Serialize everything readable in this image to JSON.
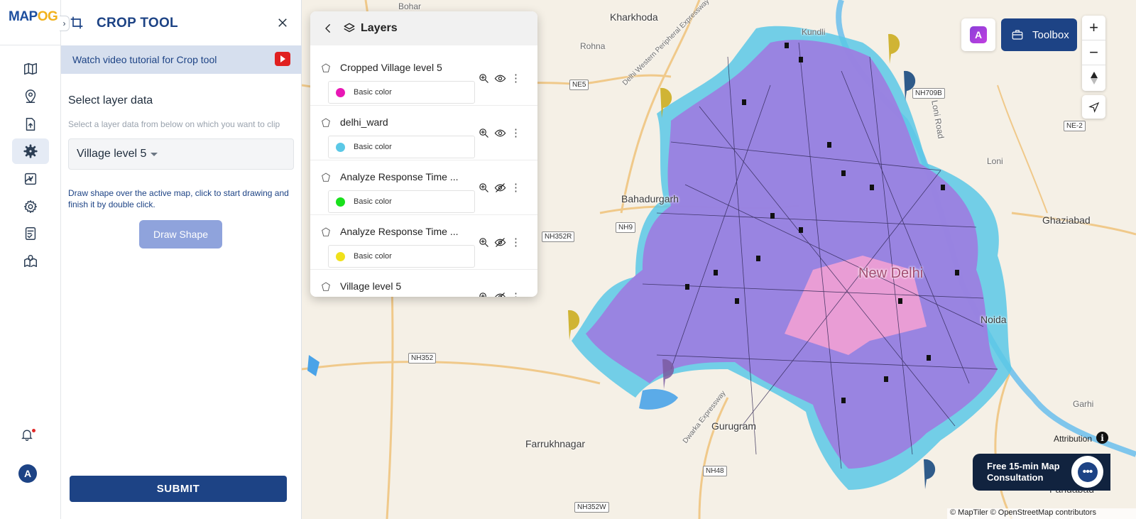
{
  "app": {
    "logo_left": "MAP",
    "logo_right": "OG"
  },
  "rail": {
    "items": [
      {
        "name": "map-icon"
      },
      {
        "name": "location-pin-icon"
      },
      {
        "name": "file-upload-icon"
      },
      {
        "name": "settings-gear-icon",
        "active": true
      },
      {
        "name": "map-marker-icon"
      },
      {
        "name": "gear-icon"
      },
      {
        "name": "report-icon"
      },
      {
        "name": "map-location-icon"
      }
    ],
    "avatar_letter": "A"
  },
  "panel": {
    "title": "CROP TOOL",
    "tutorial_label": "Watch video tutorial for Crop tool",
    "section_title": "Select layer data",
    "section_hint": "Select a layer data from below on which you want to clip",
    "selected_layer": "Village level 5",
    "draw_hint": "Draw shape over the active map, click to start drawing and finish it by double click.",
    "draw_button": "Draw Shape",
    "submit_button": "SUBMIT"
  },
  "layers": {
    "title": "Layers",
    "items": [
      {
        "name": "Cropped Village level 5",
        "style": "Basic color",
        "color": "#e817b5",
        "visible": true
      },
      {
        "name": "delhi_ward",
        "style": "Basic color",
        "color": "#5bc8e6",
        "visible": true
      },
      {
        "name": "Analyze Response Time ...",
        "style": "Basic color",
        "color": "#19e01c",
        "visible": false
      },
      {
        "name": "Analyze Response Time ...",
        "style": "Basic color",
        "color": "#f0e11b",
        "visible": false
      },
      {
        "name": "Village level 5",
        "style": "Basic color",
        "color": "#9b7fe0",
        "visible": false
      }
    ]
  },
  "map": {
    "places": {
      "bohar": "Bohar",
      "kharkhoda": "Kharkhoda",
      "rohna": "Rohna",
      "kundli": "Kundli",
      "bahadurgarh": "Bahadurgarh",
      "loni": "Loni",
      "ghaziabad": "Ghaziabad",
      "new_delhi": "New Delhi",
      "noida": "Noida",
      "gurugram": "Gurugram",
      "farrukhnagar": "Farrukhnagar",
      "faridabad": "Faridabad",
      "garhi": "Garhi",
      "loni_road": "Loni Road",
      "delhi_expressway": "Delhi Western Peripheral Expressway",
      "dwarka_expressway": "Dwarka Expressway"
    },
    "roads": {
      "ne5": "NE5",
      "nh709b": "NH709B",
      "ne2": "NE-2",
      "nh9": "NH9",
      "nh352r": "NH352R",
      "nh352": "NH352",
      "nh48": "NH48",
      "nh352w": "NH352W"
    },
    "toolbox_label": "Toolbox",
    "ai_label": "A",
    "zoom_in": "+",
    "zoom_out": "−",
    "attribution_label": "Attribution",
    "copyright": "© MapTiler © OpenStreetMap contributors",
    "consult_line1": "Free 15-min Map",
    "consult_line2": "Consultation",
    "colors": {
      "brand": "#1d4385",
      "village_fill": "#9b7fe0",
      "ward_fill": "#5bc8e6",
      "crop_fill": "#e817b5"
    }
  }
}
